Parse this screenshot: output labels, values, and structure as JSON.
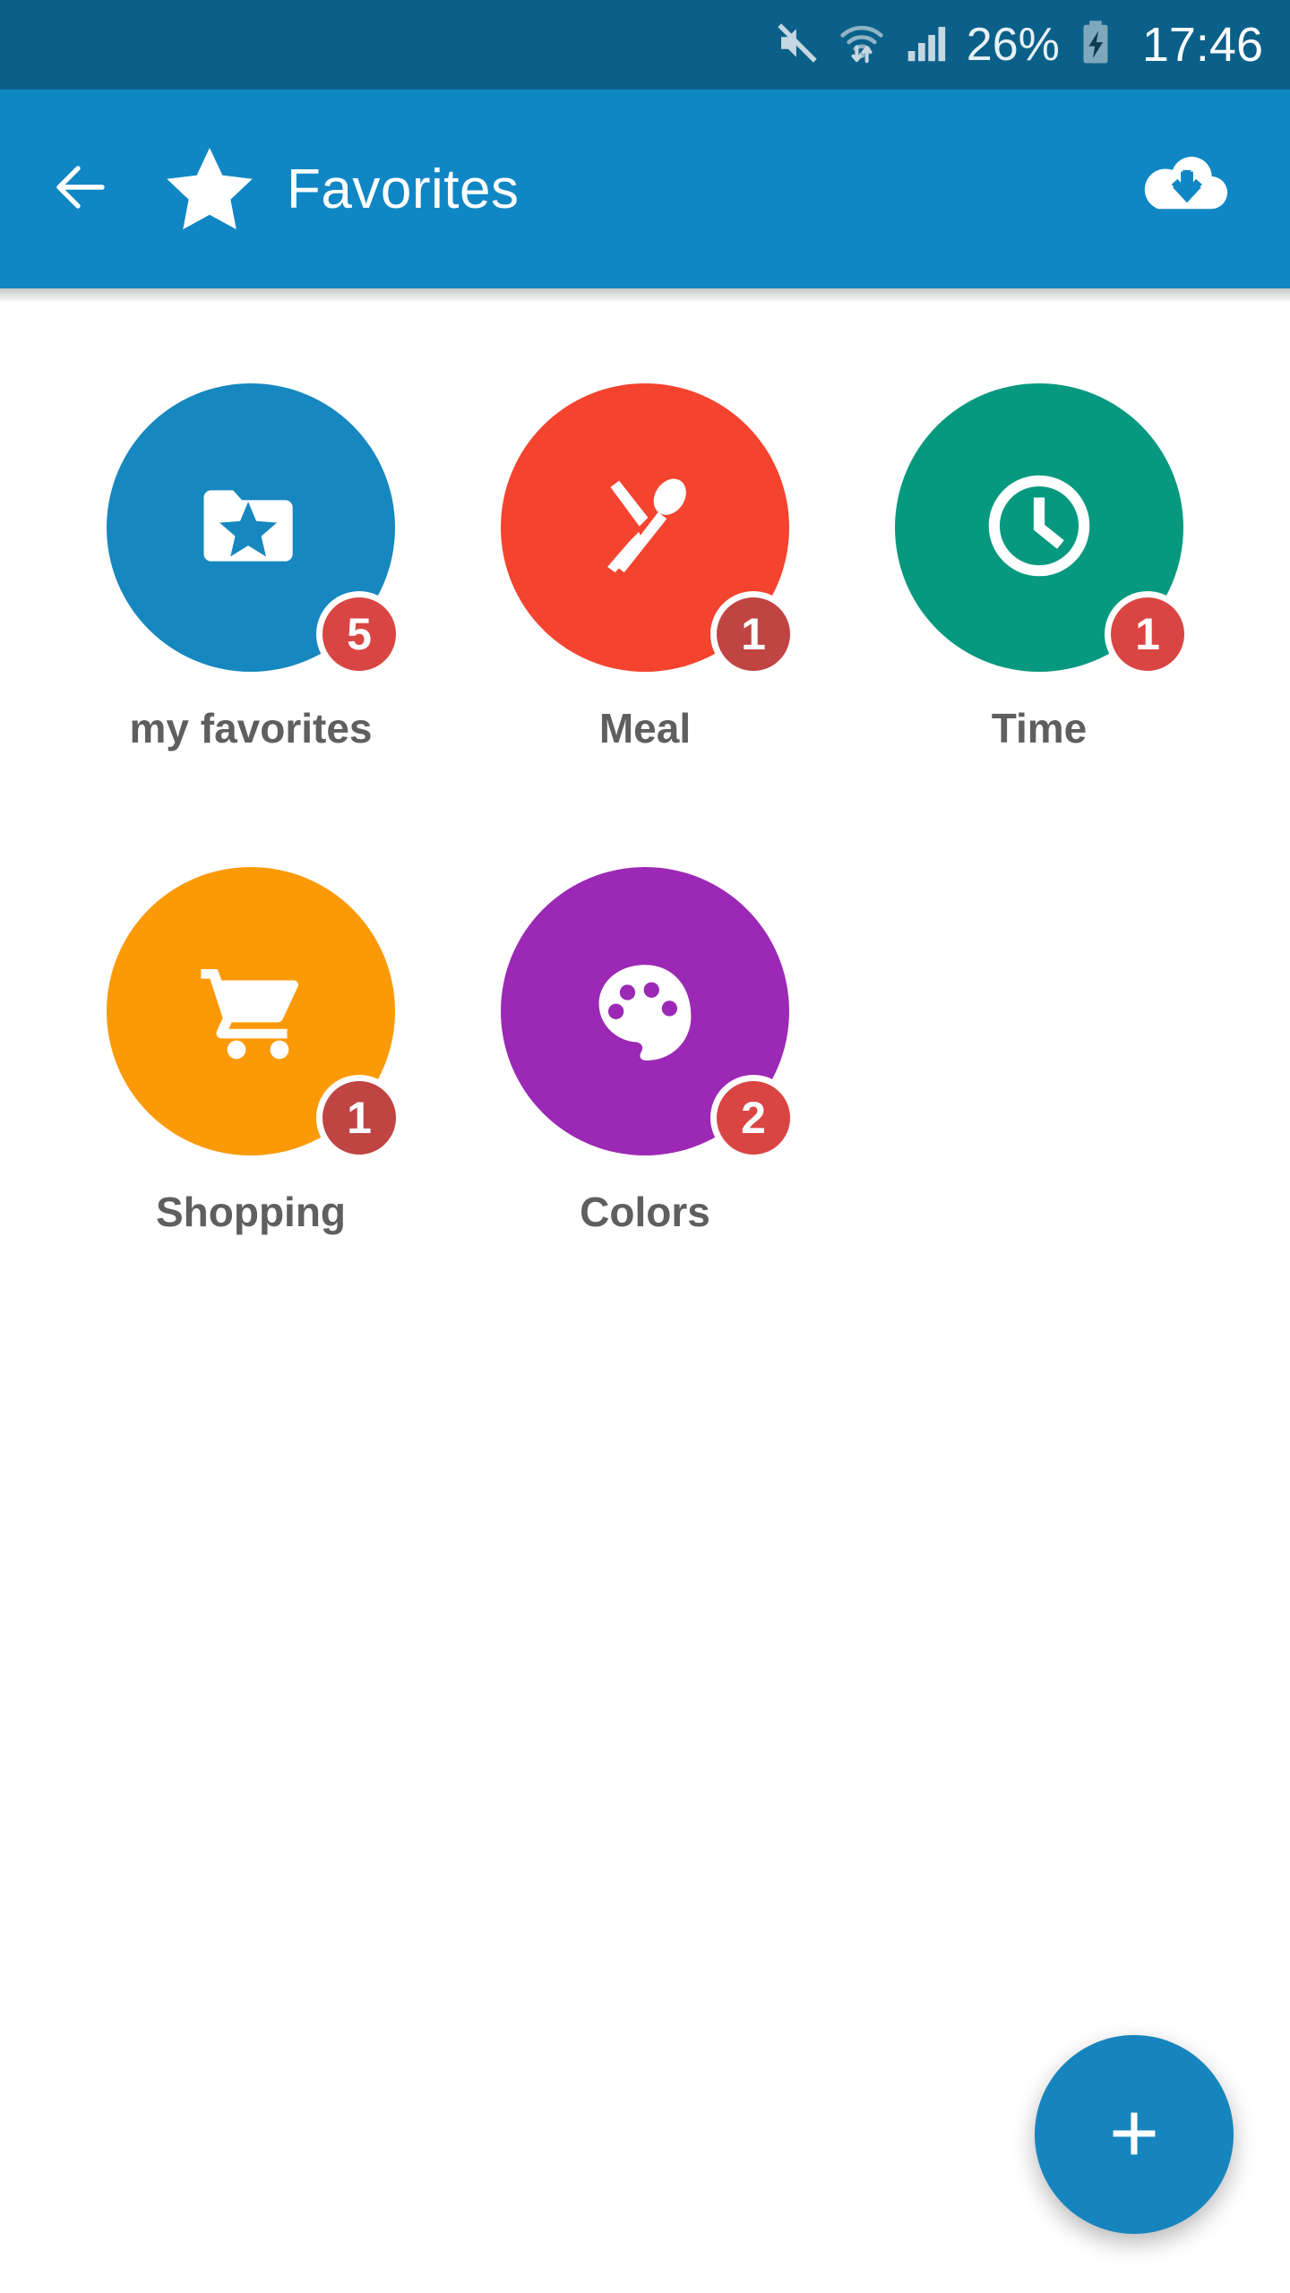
{
  "status_bar": {
    "background": "#0a6089",
    "mute_icon": "mute-icon",
    "wifi_icon": "wifi-transfer-icon",
    "signal_icon": "signal-bars-icon",
    "battery_percent": "26%",
    "battery_icon": "battery-charging-icon",
    "time": "17:46"
  },
  "app_bar": {
    "background": "#1087c4",
    "back_icon": "back-arrow-icon",
    "star_icon": "star-icon",
    "title": "Favorites",
    "cloud_download_icon": "cloud-download-icon"
  },
  "grid": {
    "items": [
      {
        "label": "my favorites",
        "icon": "folder-star-icon",
        "color": "#1787c0",
        "badge": "5",
        "badge_color": "#d94542"
      },
      {
        "label": "Meal",
        "icon": "spoon-knife-icon",
        "color": "#f4432e",
        "badge": "1",
        "badge_color": "#bf4442"
      },
      {
        "label": "Time",
        "icon": "clock-icon",
        "color": "#07997f",
        "badge": "1",
        "badge_color": "#d94542"
      },
      {
        "label": "Shopping",
        "icon": "shopping-cart-icon",
        "color": "#fb9a06",
        "badge": "1",
        "badge_color": "#bf4442"
      },
      {
        "label": "Colors",
        "icon": "palette-icon",
        "color": "#9b29b5",
        "badge": "2",
        "badge_color": "#d94542"
      }
    ]
  },
  "fab": {
    "icon": "plus-icon",
    "color": "#1785bd"
  }
}
